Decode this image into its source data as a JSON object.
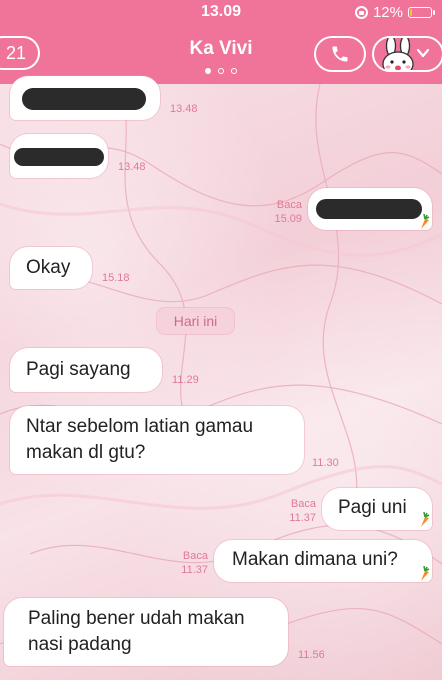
{
  "status": {
    "time": "13.09",
    "battery": "12%",
    "battery_level": 0.12
  },
  "header": {
    "back_count": "21",
    "title": "Ka Vivi",
    "page_index": 0,
    "page_count": 3
  },
  "date_divider": "Hari ini",
  "messages": [
    {
      "dir": "in",
      "text": "",
      "redacted": true,
      "time": "13.48"
    },
    {
      "dir": "in",
      "text": "",
      "redacted": true,
      "time": "13.48"
    },
    {
      "dir": "out",
      "text": "",
      "redacted": true,
      "read": "Baca",
      "time": "15.09"
    },
    {
      "dir": "in",
      "text": "Okay",
      "time": "15.18"
    },
    {
      "dir": "in",
      "text": "Pagi sayang",
      "time": "11.29"
    },
    {
      "dir": "in",
      "text_lines": [
        "Ntar sebelom latian gamau",
        "makan dl gtu?"
      ],
      "time": "11.30"
    },
    {
      "dir": "out",
      "text": "Pagi uni",
      "read": "Baca",
      "time": "11.37"
    },
    {
      "dir": "out",
      "text": "Makan dimana uni?",
      "read": "Baca",
      "time": "11.37"
    },
    {
      "dir": "in",
      "text_lines": [
        "Paling bener udah makan",
        "nasi padang"
      ],
      "time": "11.56"
    }
  ],
  "colors": {
    "header": "#f0739a",
    "timestamp": "#e07a9a",
    "bubble": "#ffffff"
  }
}
